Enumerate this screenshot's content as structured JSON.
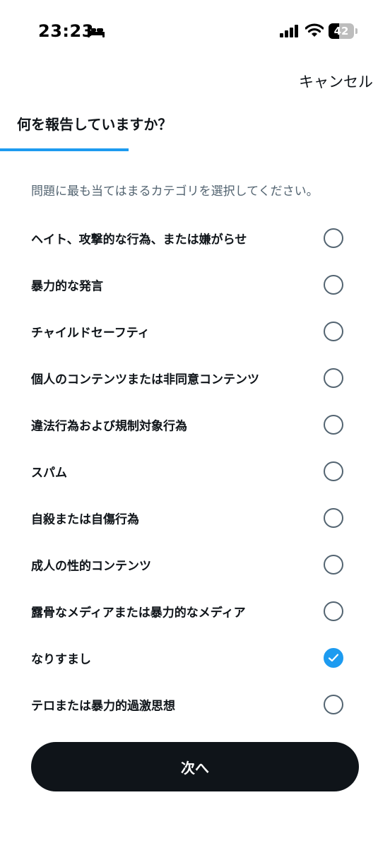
{
  "status_bar": {
    "time": "23:23",
    "battery_level": "42",
    "battery_fraction": 0.42
  },
  "header": {
    "cancel_label": "キャンセル",
    "title": "何を報告していますか？"
  },
  "progress": {
    "fraction": 0.33
  },
  "instruction": "問題に最も当てはまるカテゴリを選択してください。",
  "options": [
    {
      "label": "ヘイト、攻撃的な行為、または嫌がらせ",
      "selected": false
    },
    {
      "label": "暴力的な発言",
      "selected": false
    },
    {
      "label": "チャイルドセーフティ",
      "selected": false
    },
    {
      "label": "個人のコンテンツまたは非同意コンテンツ",
      "selected": false
    },
    {
      "label": "違法行為および規制対象行為",
      "selected": false
    },
    {
      "label": "スパム",
      "selected": false
    },
    {
      "label": "自殺または自傷行為",
      "selected": false
    },
    {
      "label": "成人の性的コンテンツ",
      "selected": false
    },
    {
      "label": "露骨なメディアまたは暴力的なメディア",
      "selected": false
    },
    {
      "label": "なりすまし",
      "selected": true
    },
    {
      "label": "テロまたは暴力的過激思想",
      "selected": false
    }
  ],
  "footer": {
    "next_label": "次へ"
  },
  "colors": {
    "accent": "#1d9bf0",
    "text": "#0f1419",
    "secondary_text": "#536471",
    "button_bg": "#0f1419"
  },
  "icons": {
    "sleep_focus": "bed-icon",
    "signal": "cellular-signal-icon",
    "wifi": "wifi-icon",
    "battery": "battery-icon",
    "selected_radio": "checkmark-icon"
  }
}
